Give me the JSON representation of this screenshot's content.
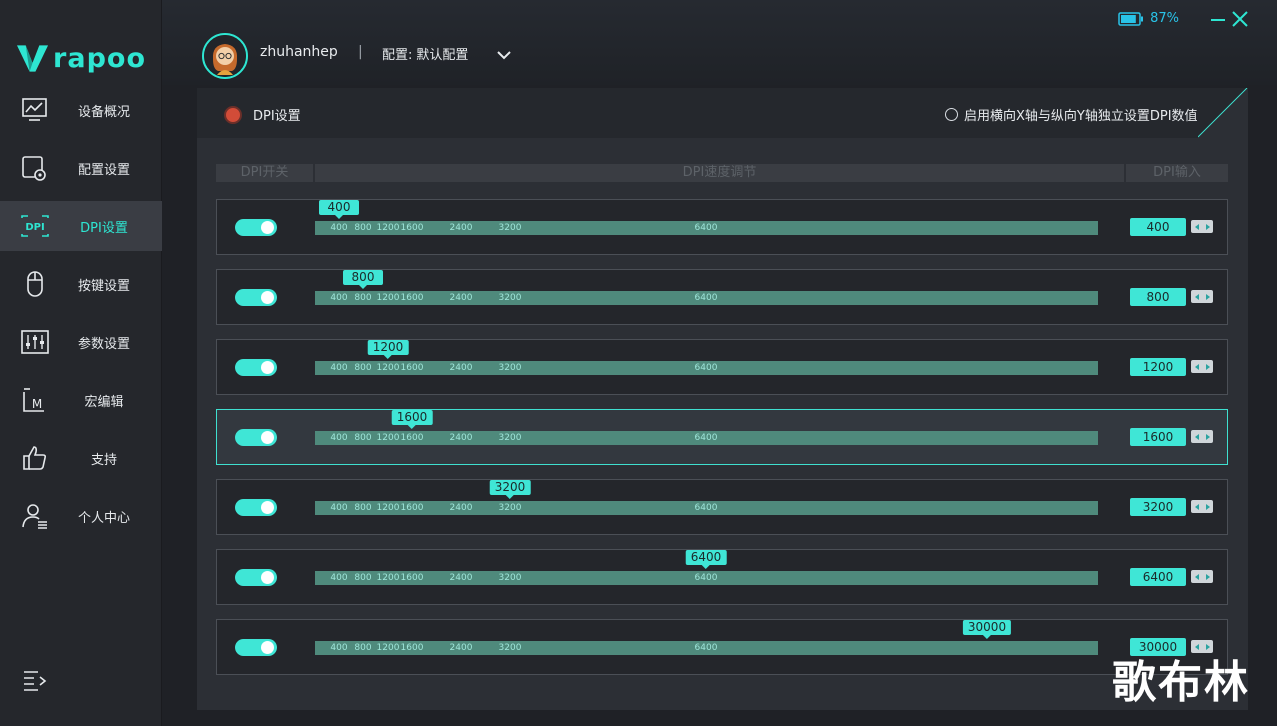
{
  "app": {
    "logo_text": "rapoo",
    "battery_percent": "87%",
    "battery_level": 0.87
  },
  "colors": {
    "accent": "#2ee6d2",
    "sidebar_bg": "#25272c",
    "panel_bg": "#2c2f35",
    "track": "#4f8a7c",
    "dot_red": "#d24c38"
  },
  "sidebar": {
    "items": [
      {
        "label": "设备概况",
        "icon": "monitor-icon",
        "active": false
      },
      {
        "label": "配置设置",
        "icon": "config-gear-icon",
        "active": false
      },
      {
        "label": "DPI设置",
        "icon": "dpi-icon",
        "active": true
      },
      {
        "label": "按键设置",
        "icon": "mouse-icon",
        "active": false
      },
      {
        "label": "参数设置",
        "icon": "sliders-icon",
        "active": false
      },
      {
        "label": "宏编辑",
        "icon": "macro-icon",
        "active": false
      },
      {
        "label": "支持",
        "icon": "thumbs-up-icon",
        "active": false
      },
      {
        "label": "个人中心",
        "icon": "user-icon",
        "active": false
      }
    ],
    "collapse_icon": "menu-expand-icon"
  },
  "topbar": {
    "username": "zhuhanhep",
    "separator": "|",
    "profile_prefix": "配置:",
    "profile_name": "默认配置"
  },
  "panel": {
    "title": "DPI设置",
    "xy_option_label": "启用横向X轴与纵向Y轴独立设置DPI数值",
    "col_switch": "DPI开关",
    "col_speed": "DPI速度调节",
    "col_input": "DPI输入"
  },
  "ticks": [
    "400",
    "800",
    "1200",
    "1600",
    "2400",
    "3200",
    "6400"
  ],
  "rows": [
    {
      "enabled": true,
      "value": "400",
      "active": false
    },
    {
      "enabled": true,
      "value": "800",
      "active": false
    },
    {
      "enabled": true,
      "value": "1200",
      "active": false
    },
    {
      "enabled": true,
      "value": "1600",
      "active": true
    },
    {
      "enabled": true,
      "value": "3200",
      "active": false
    },
    {
      "enabled": true,
      "value": "6400",
      "active": false
    },
    {
      "enabled": true,
      "value": "30000",
      "active": false
    }
  ],
  "watermark": "歌布林"
}
